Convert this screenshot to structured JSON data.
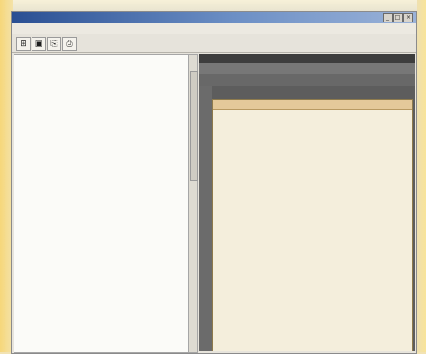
{
  "window": {
    "title": "",
    "controls": {
      "minimize": "_",
      "maximize": "□",
      "close": "×"
    }
  },
  "menu": [],
  "toolbar": {
    "buttons": [
      {
        "icon": "open-icon",
        "glyph": "⊞"
      },
      {
        "icon": "save-icon",
        "glyph": "▣"
      },
      {
        "icon": "copy-icon",
        "glyph": "⎘"
      },
      {
        "icon": "print-icon",
        "glyph": "⎙"
      }
    ]
  },
  "tree": [],
  "doc": {
    "header": "",
    "columns": [],
    "page_title": "",
    "lines": []
  },
  "colors": {
    "titlebar_start": "#2a4f93",
    "selection": "#1f3a8a",
    "page_bg": "#f4eedc",
    "highlight_red": "#c21e1e"
  }
}
